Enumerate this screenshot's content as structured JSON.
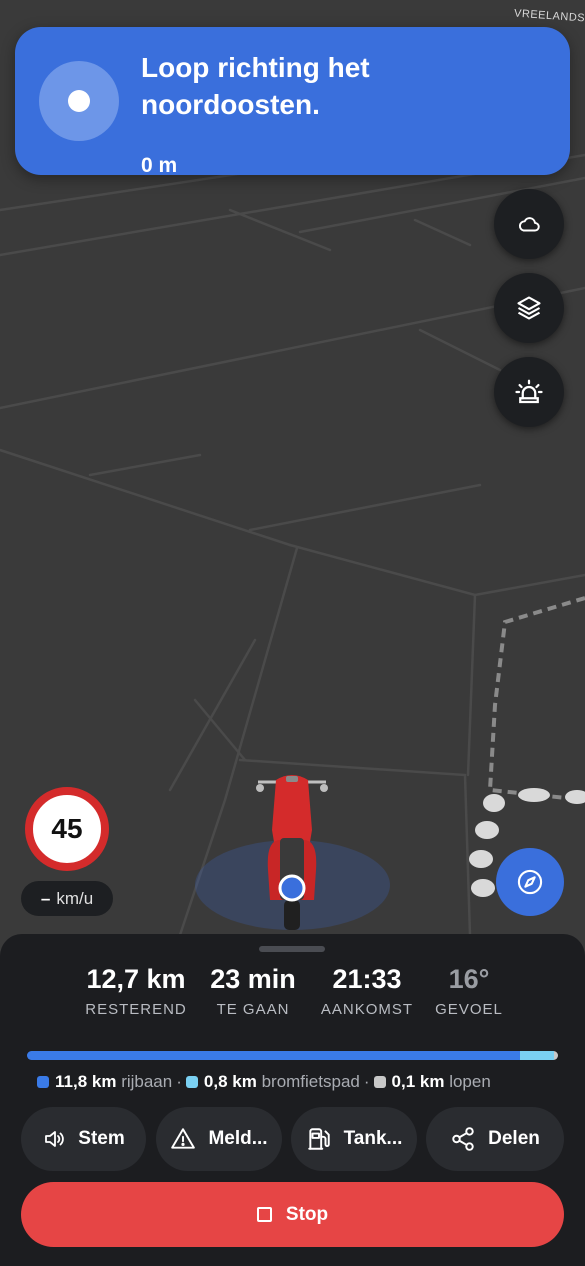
{
  "map": {
    "street_label": "VREELANDS"
  },
  "instruction": {
    "text": "Loop richting het noordoosten.",
    "distance": "0 m"
  },
  "map_buttons": {
    "weather_icon": "cloud-icon",
    "layers_icon": "layers-icon",
    "alerts_icon": "siren-icon",
    "recenter_icon": "compass-icon"
  },
  "speed": {
    "limit": "45",
    "current": "–",
    "unit": "km/u"
  },
  "trip": {
    "remaining": {
      "value": "12,7 km",
      "label": "RESTEREND"
    },
    "duration": {
      "value": "23 min",
      "label": "TE GAAN"
    },
    "arrival": {
      "value": "21:33",
      "label": "AANKOMST"
    },
    "feels_like": {
      "value": "16°",
      "label": "GEVOEL"
    }
  },
  "route_breakdown": {
    "segments": [
      {
        "distance": "11,8 km",
        "label": "rijbaan",
        "fraction": 0.929,
        "color": "#3a7be8"
      },
      {
        "distance": "0,8 km",
        "label": "bromfietspad",
        "fraction": 0.063,
        "color": "#7ad0f2"
      },
      {
        "distance": "0,1 km",
        "label": "lopen",
        "fraction": 0.008,
        "color": "#c8c8c8"
      }
    ],
    "separator": "·"
  },
  "actions": {
    "voice": "Stem",
    "report": "Meld...",
    "fuel": "Tank...",
    "share": "Delen",
    "stop": "Stop"
  },
  "colors": {
    "accent": "#3a6fdc",
    "stop": "#e64545",
    "speed_ring": "#d42b2b",
    "scooter": "#d42b2b"
  }
}
